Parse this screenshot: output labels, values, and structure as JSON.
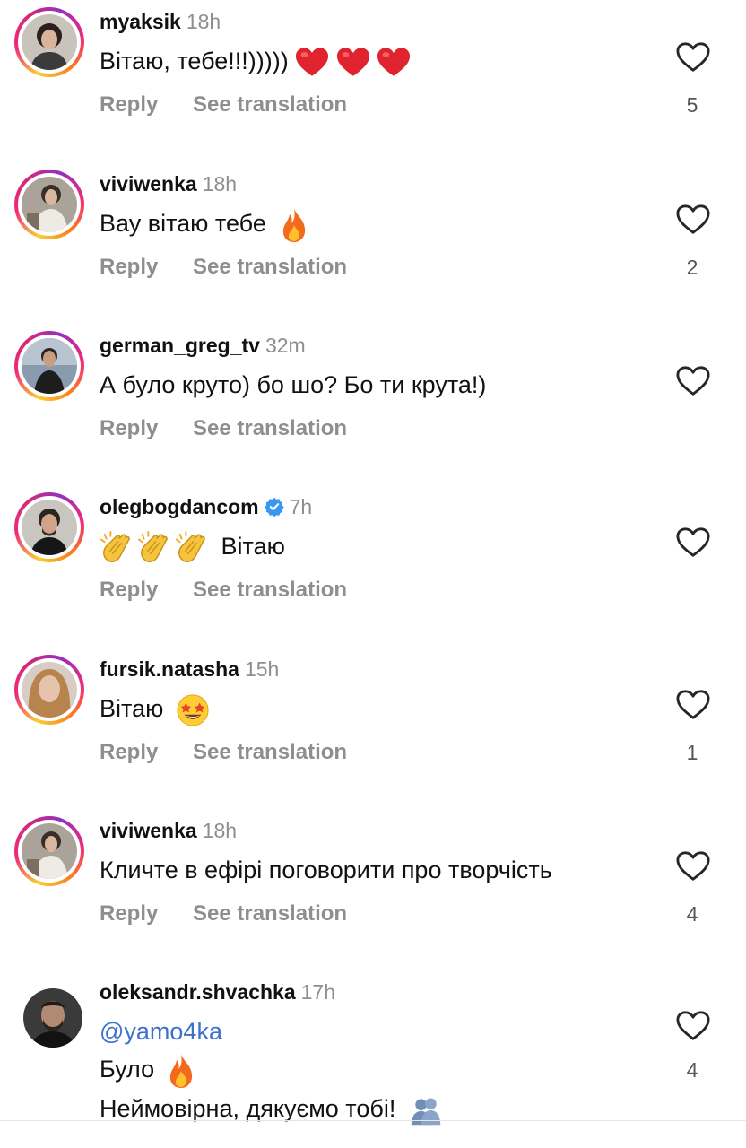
{
  "actions": {
    "reply_label": "Reply",
    "translation_label": "See translation"
  },
  "comments": [
    {
      "username": "myaksik",
      "time": "18h",
      "text": "Вітаю, тебе!!!)))))",
      "likes": "5"
    },
    {
      "username": "viviwenka",
      "time": "18h",
      "text": "Вау вітаю тебе",
      "likes": "2"
    },
    {
      "username": "german_greg_tv",
      "time": "32m",
      "text": "А було круто) бо шо? Бо ти крута!)",
      "likes": ""
    },
    {
      "username": "olegbogdancom",
      "time": "7h",
      "text": "Вітаю",
      "likes": ""
    },
    {
      "username": "fursik.natasha",
      "time": "15h",
      "text": "Вітаю",
      "likes": "1"
    },
    {
      "username": "viviwenka",
      "time": "18h",
      "text": "Кличте в ефірі поговорити про творчість",
      "likes": "4"
    },
    {
      "username": "oleksandr.shvachka",
      "time": "17h",
      "mention": "@yamo4ka",
      "line2": "Було",
      "line3": "Неймовірна, дякуємо тобі!",
      "likes": "4"
    }
  ],
  "colors": {
    "link": "#3f6fd0",
    "verified": "#3897f0",
    "muted": "#8e8e8e"
  }
}
